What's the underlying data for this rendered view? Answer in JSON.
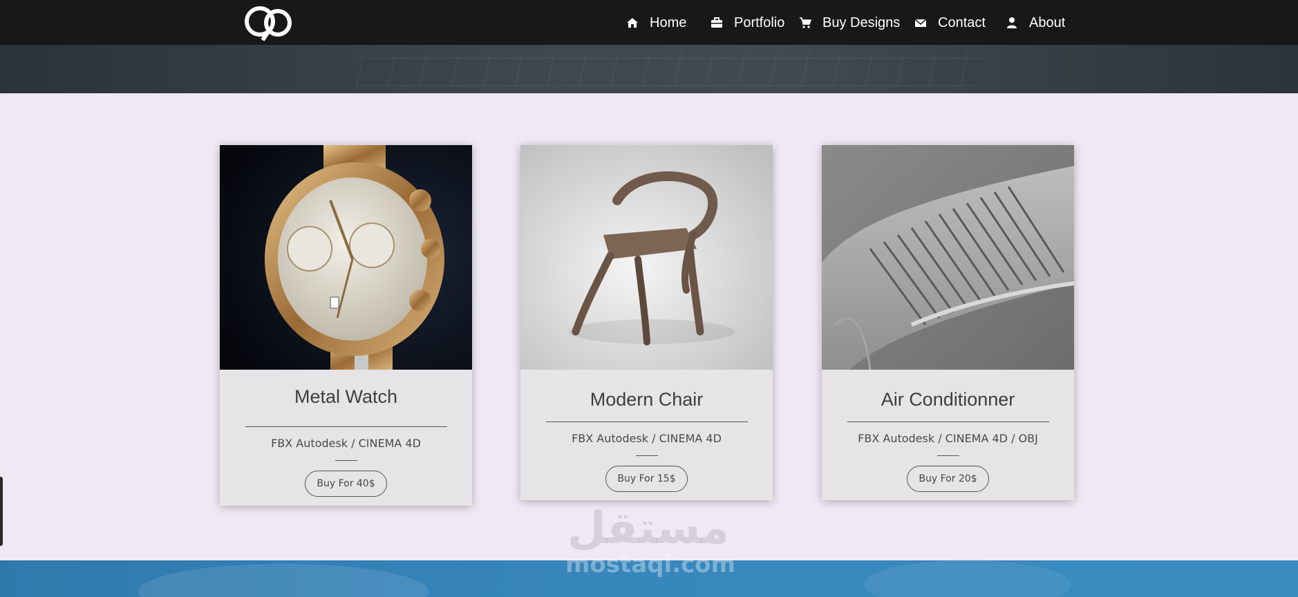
{
  "nav": {
    "items": [
      {
        "label": "Home",
        "icon": "home-icon"
      },
      {
        "label": "Portfolio",
        "icon": "briefcase-icon"
      },
      {
        "label": "Buy Designs",
        "icon": "cart-icon"
      },
      {
        "label": "Contact",
        "icon": "envelope-icon"
      },
      {
        "label": "About",
        "icon": "user-icon"
      }
    ]
  },
  "products": [
    {
      "title": "Metal Watch",
      "formats": "FBX Autodesk / CINEMA 4D",
      "button": "Buy For 40$",
      "image": "metal-watch-image"
    },
    {
      "title": "Modern Chair",
      "formats": "FBX Autodesk / CINEMA 4D",
      "button": "Buy For 15$",
      "image": "modern-chair-image"
    },
    {
      "title": "Air Conditionner",
      "formats": "FBX Autodesk / CINEMA 4D / OBJ",
      "button": "Buy For 20$",
      "image": "air-conditioner-image"
    }
  ],
  "watermark": {
    "arabic": "مستقل",
    "latin": "mostaql.com"
  },
  "colors": {
    "navbar": "#181818",
    "page": "#efe9f5",
    "card": "#e6e4e6",
    "footer": "#3787bd"
  }
}
